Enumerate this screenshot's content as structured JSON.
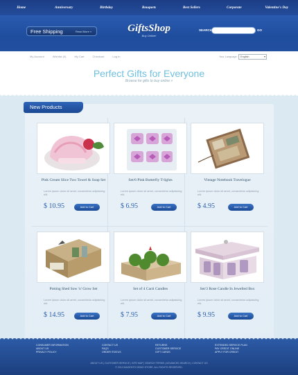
{
  "nav": [
    "Home",
    "Anniversary",
    "Birthday",
    "Bouquets",
    "Best Sellers",
    "Corporate",
    "Valentine's Day"
  ],
  "header": {
    "free_shipping": "Free Shipping",
    "read_more": "Read More »",
    "logo": "GiftsShop",
    "logo_tagline": "Buy Online!",
    "search_label": "SEARCH",
    "search_value": "",
    "search_go": "GO"
  },
  "utility": {
    "links": [
      "My Account",
      "Wishlist (0)",
      "My Cart",
      "Checkout",
      "Log In"
    ],
    "language_label": "Your Language:",
    "language_value": "English"
  },
  "banner": {
    "title": "Perfect Gifts for Everyone",
    "subtitle": "Browse for gifts to buy online »"
  },
  "section_title": "New Products",
  "products": [
    {
      "name": "Pink Cream Slice Two Towel & Soap Set",
      "desc": "Lorem ipsum dolor sit amet, consectetur adipisicing elit.",
      "price": "$ 10.95",
      "cta": "Add to Cart"
    },
    {
      "name": "Set/6 Pink Butterfly T-lights",
      "desc": "Lorem ipsum dolor sit amet, consectetur adipisicing elit.",
      "price": "$ 6.95",
      "cta": "Add to Cart"
    },
    {
      "name": "Vintage Notebook Travelogue",
      "desc": "Lorem ipsum dolor sit amet, consectetur adipisicing elit.",
      "price": "$ 4.95",
      "cta": "Add to Cart"
    },
    {
      "name": "Potting Shed Sow 'n' Grow Set",
      "desc": "Lorem ipsum dolor sit amet, consectetur adipisicing elit.",
      "price": "$ 14.95",
      "cta": "Add to Cart"
    },
    {
      "name": "Set of 4 Cacti Candles",
      "desc": "Lorem ipsum dolor sit amet, consectetur adipisicing elit.",
      "price": "$ 7.95",
      "cta": "Add to Cart"
    },
    {
      "name": "Set/3 Rose Candle In Jewelled Box",
      "desc": "Lorem ipsum dolor sit amet, consectetur adipisicing elit.",
      "price": "$ 9.95",
      "cta": "Add to Cart"
    }
  ],
  "footer": {
    "col1": [
      "CONSUMER INFORMATION",
      "ABOUT US",
      "PRIVACY POLICY"
    ],
    "col2": [
      "CONTACT US",
      "FAQS",
      "ORDER STATUS"
    ],
    "col3": [
      "RETURNS",
      "CUSTOMER SERVICE",
      "GIFT CARDS"
    ],
    "col4": [
      "EXTENDED SERVICE PLAN",
      "PAY CREDIT ONLINE",
      "APPLY FOR CREDIT"
    ],
    "bottom_links": "ABOUT US  |  CUSTOMER SERVICE  |  SITE MAP  |  SEARCH TERMS  |  ADVANCED SEARCH  |  CONTACT US",
    "copyright": "© 2012 MAGENTO DEMO STORE. ALL RIGHTS RESERVED."
  }
}
